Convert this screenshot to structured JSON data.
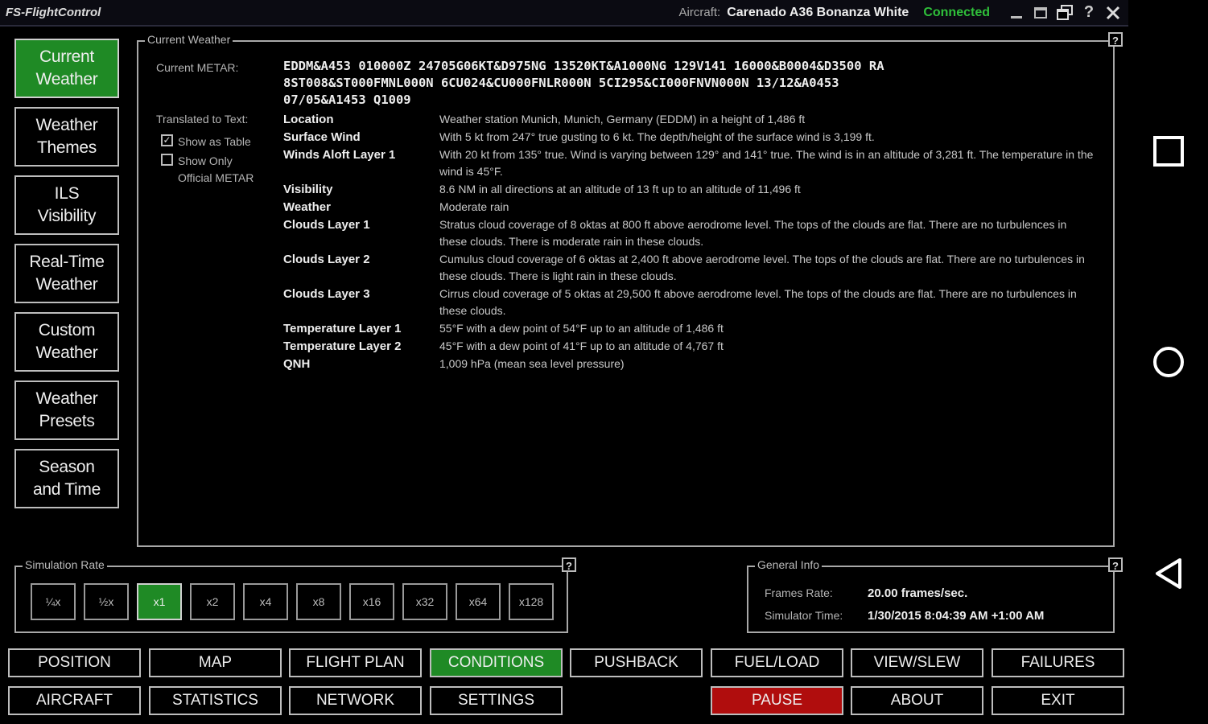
{
  "titlebar": {
    "app_title": "FS-FlightControl",
    "aircraft_label": "Aircraft:",
    "aircraft_name": "Carenado A36 Bonanza White",
    "status": "Connected"
  },
  "sidebar": {
    "items": [
      {
        "label": "Current\nWeather",
        "active": true
      },
      {
        "label": "Weather\nThemes",
        "active": false
      },
      {
        "label": "ILS\nVisibility",
        "active": false
      },
      {
        "label": "Real-Time\nWeather",
        "active": false
      },
      {
        "label": "Custom\nWeather",
        "active": false
      },
      {
        "label": "Weather\nPresets",
        "active": false
      },
      {
        "label": "Season\nand Time",
        "active": false
      }
    ]
  },
  "current_weather": {
    "title": "Current Weather",
    "metar_label": "Current METAR:",
    "metar": "EDDM&A453 010000Z 24705G06KT&D975NG 13520KT&A1000NG 129V141 16000&B0004&D3500 RA\n8ST008&ST000FMNL000N 6CU024&CU000FNLR000N 5CI295&CI000FNVN000N 13/12&A0453\n07/05&A1453 Q1009",
    "translated_label": "Translated to Text:",
    "show_as_table_label": "Show as Table",
    "show_as_table_checked": true,
    "show_only_official_label": "Show Only\nOfficial METAR",
    "show_only_official_checked": false,
    "rows": [
      {
        "key": "Location",
        "value": "Weather station Munich, Munich, Germany (EDDM) in a height of 1,486 ft"
      },
      {
        "key": "Surface Wind",
        "value": "With 5 kt from 247° true gusting to 6 kt. The depth/height of the surface wind is 3,199 ft."
      },
      {
        "key": "Winds Aloft Layer 1",
        "value": "With 20 kt from 135° true. Wind is varying between 129° and 141° true. The wind is in an altitude of 3,281 ft. The temperature in the wind is 45°F."
      },
      {
        "key": "Visibility",
        "value": "8.6 NM in all directions at an altitude of 13 ft up to an altitude of 11,496 ft"
      },
      {
        "key": "Weather",
        "value": "Moderate rain"
      },
      {
        "key": "Clouds Layer 1",
        "value": "Stratus cloud coverage of 8 oktas at 800 ft above aerodrome level. The tops of the clouds are flat. There are no turbulences in these clouds. There is moderate rain in these clouds."
      },
      {
        "key": "Clouds Layer 2",
        "value": "Cumulus cloud coverage of 6 oktas at 2,400 ft above aerodrome level. The tops of the clouds are flat. There are no turbulences in these clouds. There is light rain in these clouds."
      },
      {
        "key": "Clouds Layer 3",
        "value": "Cirrus cloud coverage of 5 oktas at 29,500 ft above aerodrome level. The tops of the clouds are flat. There are no turbulences in these clouds."
      },
      {
        "key": "Temperature Layer 1",
        "value": "55°F with a dew point of 54°F up to an altitude of 1,486 ft"
      },
      {
        "key": "Temperature Layer 2",
        "value": "45°F with a dew point of 41°F up to an altitude of 4,767 ft"
      },
      {
        "key": "QNH",
        "value": "1,009 hPa (mean sea level pressure)"
      }
    ]
  },
  "simulation_rate": {
    "title": "Simulation Rate",
    "rates": [
      {
        "label": "¼x",
        "active": false
      },
      {
        "label": "½x",
        "active": false
      },
      {
        "label": "x1",
        "active": true
      },
      {
        "label": "x2",
        "active": false
      },
      {
        "label": "x4",
        "active": false
      },
      {
        "label": "x8",
        "active": false
      },
      {
        "label": "x16",
        "active": false
      },
      {
        "label": "x32",
        "active": false
      },
      {
        "label": "x64",
        "active": false
      },
      {
        "label": "x128",
        "active": false
      }
    ]
  },
  "general_info": {
    "title": "General Info",
    "frame_rate_label": "Frames Rate:",
    "frame_rate_value": "20.00 frames/sec.",
    "sim_time_label": "Simulator Time:",
    "sim_time_value": "1/30/2015 8:04:39 AM +1:00 AM"
  },
  "bottom_nav": {
    "row1": [
      {
        "label": "POSITION",
        "state": "normal"
      },
      {
        "label": "MAP",
        "state": "normal"
      },
      {
        "label": "FLIGHT PLAN",
        "state": "normal"
      },
      {
        "label": "CONDITIONS",
        "state": "active"
      },
      {
        "label": "PUSHBACK",
        "state": "normal"
      },
      {
        "label": "FUEL/LOAD",
        "state": "normal"
      },
      {
        "label": "VIEW/SLEW",
        "state": "normal"
      },
      {
        "label": "FAILURES",
        "state": "normal"
      }
    ],
    "row2": [
      {
        "label": "AIRCRAFT",
        "state": "normal"
      },
      {
        "label": "STATISTICS",
        "state": "normal"
      },
      {
        "label": "NETWORK",
        "state": "normal"
      },
      {
        "label": "SETTINGS",
        "state": "normal"
      },
      null,
      {
        "label": "PAUSE",
        "state": "pause"
      },
      {
        "label": "ABOUT",
        "state": "normal"
      },
      {
        "label": "EXIT",
        "state": "normal"
      }
    ]
  },
  "android_nav": {
    "icons": [
      "recents-icon",
      "home-icon",
      "back-icon"
    ]
  },
  "colors": {
    "active_green": "#1f8a25",
    "pause_red": "#b00d0d",
    "connected_green": "#2fbf3a"
  }
}
